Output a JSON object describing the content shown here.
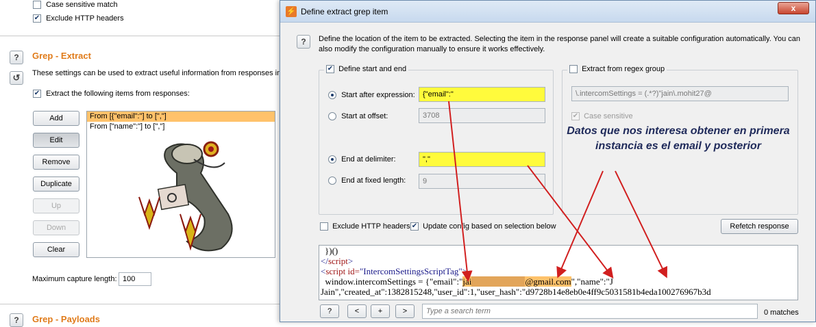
{
  "background": {
    "case_sensitive_label": "Case sensitive match",
    "exclude_headers_label": "Exclude HTTP headers",
    "grep_extract_title": "Grep - Extract",
    "grep_extract_desc": "These settings can be used to extract useful information from responses in",
    "extract_items_label": "Extract the following items from responses:",
    "buttons": {
      "add": "Add",
      "edit": "Edit",
      "remove": "Remove",
      "duplicate": "Duplicate",
      "up": "Up",
      "down": "Down",
      "clear": "Clear"
    },
    "list_items": [
      "From [{\"email\":\"] to [\",\"]",
      "From [\"name\":\"] to [\",\"]"
    ],
    "max_capture_label": "Maximum capture length:",
    "max_capture_value": "100",
    "grep_payloads_title": "Grep - Payloads"
  },
  "dialog": {
    "title": "Define extract grep item",
    "close_glyph": "x",
    "help_glyph": "?",
    "description": "Define the location of the item to be extracted. Selecting the item in the response panel will create a suitable configuration automatically. You can also modify the configuration manually to ensure it works effectively.",
    "define_start_end_label": "Define start and end",
    "start_after_label": "Start after expression:",
    "start_after_value": "{\"email\":\"",
    "start_offset_label": "Start at offset:",
    "start_offset_value": "3708",
    "end_delimiter_label": "End at delimiter:",
    "end_delimiter_value": "\",\"",
    "end_fixed_label": "End at fixed length:",
    "end_fixed_value": "9",
    "regex_group_label": "Extract from regex group",
    "regex_value": "\\.intercomSettings = (.*?)\"jain\\.mohit27@",
    "case_sensitive_label": "Case sensitive",
    "exclude_headers_label": "Exclude HTTP headers",
    "update_config_label": "Update config based on selection below",
    "refetch_button": "Refetch response",
    "annotation": "Datos que nos interesa obtener en primera instancia es el email y posterior",
    "code": {
      "line1": "})()",
      "line2_open": "</",
      "line2_tag": "script",
      "line2_close": ">",
      "line3_open": "<",
      "line3_tag": "script",
      "line3_attr": " id=",
      "line3_val": "\"IntercomSettingsScriptTag\"",
      "line3_close": ">",
      "line4_pre": "  window.intercomSettings = {\"email\":\"",
      "line4_email_start": "jai",
      "line4_email_redacted": "xxxxxxxxxxxx",
      "line4_email_end": "@gmail.com",
      "line4_post": "\",\"name\":\"J",
      "line5": "Jain\",\"created_at\":1382815248,\"user_id\":1,\"user_hash\":\"d9728b14e8eb0e4ff9c5031581b4eda100276967b3d"
    },
    "search": {
      "help": "?",
      "prev": "<",
      "add": "+",
      "next": ">",
      "placeholder": "Type a search term",
      "matches": "0 matches"
    }
  }
}
